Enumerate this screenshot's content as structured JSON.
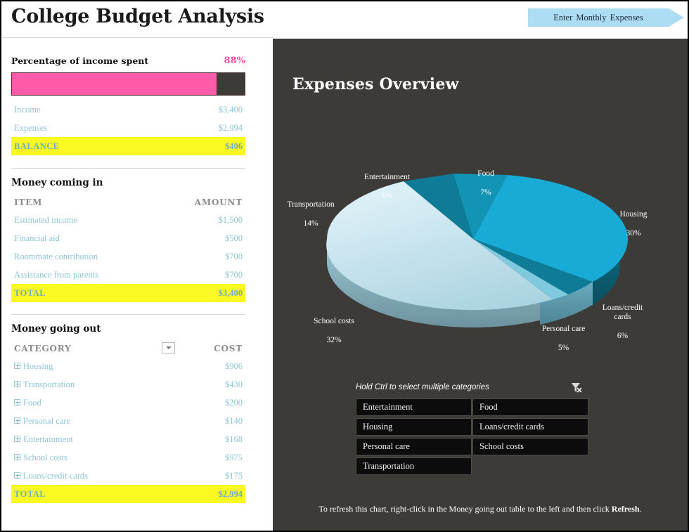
{
  "header": {
    "title": "College Budget Analysis",
    "enter_expenses_label": "Enter  Monthly  Expenses",
    "button_color": "#ADDDF5"
  },
  "summary": {
    "pct_label": "Percentage of income spent",
    "pct_value": "88%",
    "pct_number": 88,
    "bar_fill_color": "#FF5BA8",
    "bar_track_color": "#3d3b38",
    "rows": [
      {
        "label": "Income",
        "value": "$3,400"
      },
      {
        "label": "Expenses",
        "value": "$2,994"
      }
    ],
    "total": {
      "label": "BALANCE",
      "value": "$406"
    }
  },
  "money_in": {
    "heading": "Money coming in",
    "col_item": "ITEM",
    "col_amount": "AMOUNT",
    "rows": [
      {
        "item": "Estimated income",
        "amount": "$1,500"
      },
      {
        "item": "Financial aid",
        "amount": "$500"
      },
      {
        "item": "Roommate contribution",
        "amount": "$700"
      },
      {
        "item": "Assistance from parents",
        "amount": "$700"
      }
    ],
    "total": {
      "label": "TOTAL",
      "value": "$3,400"
    }
  },
  "money_out": {
    "heading": "Money going out",
    "col_category": "CATEGORY",
    "col_cost": "COST",
    "rows": [
      {
        "category": "Housing",
        "cost": "$906"
      },
      {
        "category": "Transportation",
        "cost": "$430"
      },
      {
        "category": "Food",
        "cost": "$200"
      },
      {
        "category": "Personal care",
        "cost": "$140"
      },
      {
        "category": "Entertainment",
        "cost": "$168"
      },
      {
        "category": "School costs",
        "cost": "$975"
      },
      {
        "category": "Loans/credit cards",
        "cost": "$175"
      }
    ],
    "total": {
      "label": "TOTAL",
      "value": "$2,994"
    }
  },
  "chart_panel": {
    "title": "Expenses Overview",
    "background": "#3d3b38",
    "footer_note_pre": "To refresh this chart, right-click in the Money going out table to the left and then click ",
    "footer_note_bold": "Refresh",
    "footer_note_post": "."
  },
  "chart_data": {
    "type": "pie",
    "title": "Expenses Overview",
    "labels": [
      "Housing",
      "Loans/credit cards",
      "Personal care",
      "School costs",
      "Transportation",
      "Entertainment",
      "Food"
    ],
    "values": [
      30,
      6,
      5,
      32,
      14,
      6,
      7
    ],
    "value_unit": "%",
    "data_labels": [
      {
        "name": "Housing",
        "percent": "30%",
        "color": "#18ABD6"
      },
      {
        "name": "Loans/credit\ncards",
        "percent": "6%",
        "color": "#0E7C96"
      },
      {
        "name": "Personal  care",
        "percent": "5%",
        "color": "#7FC9DE"
      },
      {
        "name": "School  costs",
        "percent": "32%",
        "color": "#AFD9E6"
      },
      {
        "name": "Transportation",
        "percent": "14%",
        "color": "#D6EEF6"
      },
      {
        "name": "Entertainment",
        "percent": "6%",
        "color": "#0E7C96"
      },
      {
        "name": "Food",
        "percent": "7%",
        "color": "#1295B5"
      }
    ],
    "legend": "none",
    "three_d": true
  },
  "slicer": {
    "hint": "Hold Ctrl to select multiple categories",
    "clear_icon": "clear-filter-icon",
    "buttons": [
      "Entertainment",
      "Food",
      "Housing",
      "Loans/credit cards",
      "Personal care",
      "School costs",
      "Transportation"
    ]
  }
}
